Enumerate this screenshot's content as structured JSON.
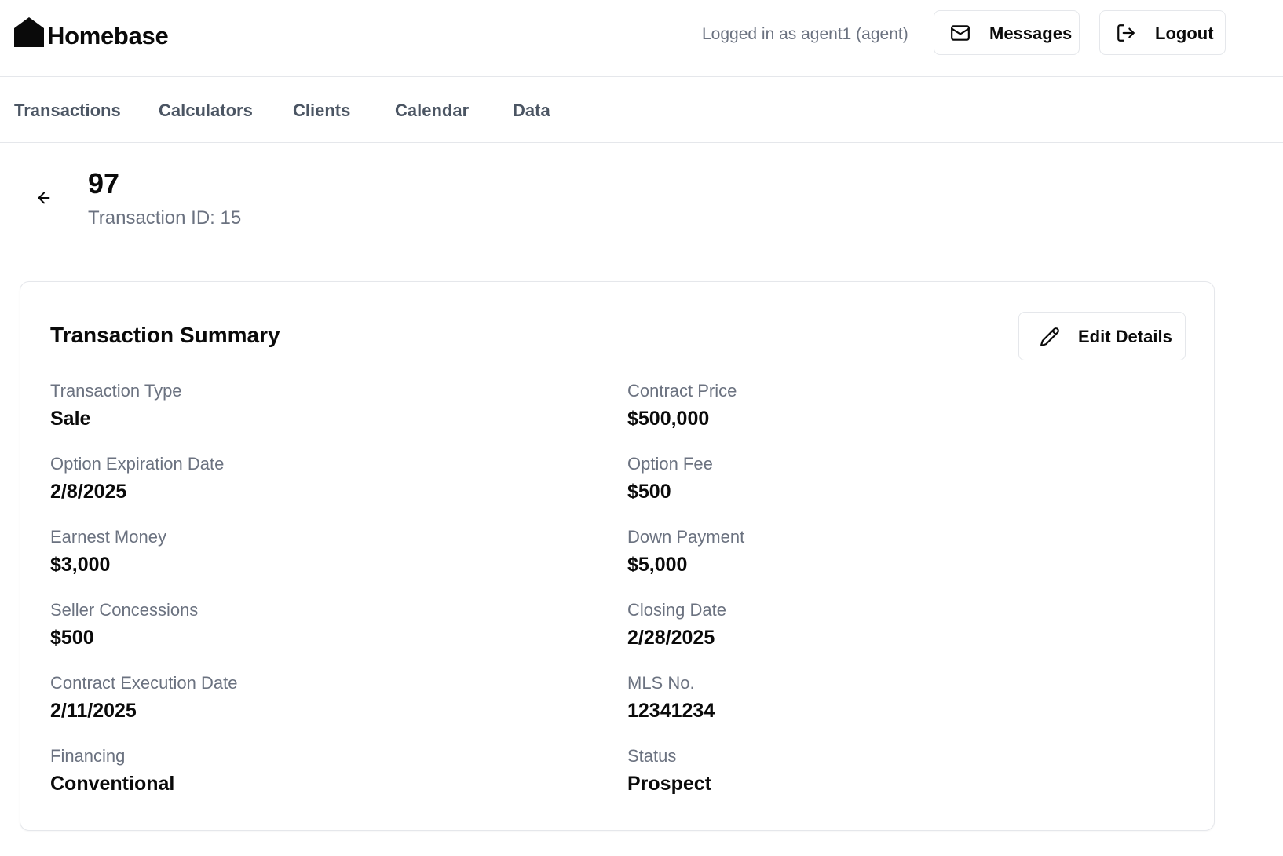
{
  "app": {
    "name": "Homebase",
    "login_text": "Logged in as agent1 (agent)"
  },
  "header": {
    "messages_label": "Messages",
    "logout_label": "Logout"
  },
  "nav": {
    "items": [
      {
        "label": "Transactions"
      },
      {
        "label": "Calculators"
      },
      {
        "label": "Clients"
      },
      {
        "label": "Calendar"
      },
      {
        "label": "Data"
      }
    ]
  },
  "page": {
    "title": "97",
    "subtitle": "Transaction ID: 15"
  },
  "summary": {
    "title": "Transaction Summary",
    "edit_label": "Edit Details",
    "fields": [
      {
        "label": "Transaction Type",
        "value": "Sale"
      },
      {
        "label": "Contract Price",
        "value": "$500,000"
      },
      {
        "label": "Option Expiration Date",
        "value": "2/8/2025"
      },
      {
        "label": "Option Fee",
        "value": "$500"
      },
      {
        "label": "Earnest Money",
        "value": "$3,000"
      },
      {
        "label": "Down Payment",
        "value": "$5,000"
      },
      {
        "label": "Seller Concessions",
        "value": "$500"
      },
      {
        "label": "Closing Date",
        "value": "2/28/2025"
      },
      {
        "label": "Contract Execution Date",
        "value": "2/11/2025"
      },
      {
        "label": "MLS No.",
        "value": "12341234"
      },
      {
        "label": "Financing",
        "value": "Conventional"
      },
      {
        "label": "Status",
        "value": "Prospect"
      }
    ]
  },
  "icons": {
    "logo": "house-icon",
    "messages": "mail-icon",
    "logout": "logout-icon",
    "back": "arrow-left-icon",
    "edit": "pencil-icon"
  }
}
